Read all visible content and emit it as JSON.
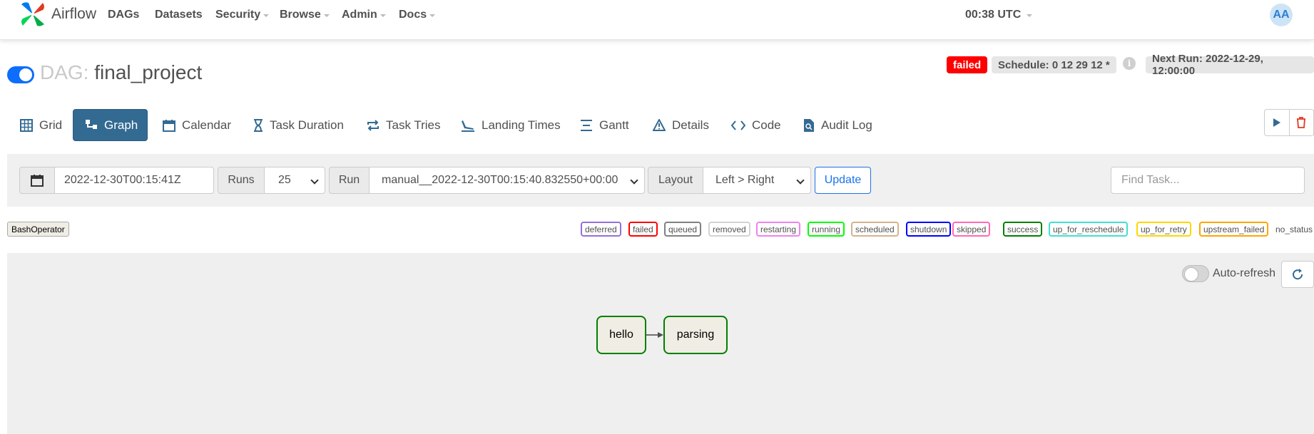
{
  "brand": {
    "name": "Airflow"
  },
  "nav": {
    "items": [
      {
        "label": "DAGs",
        "dropdown": false
      },
      {
        "label": "Datasets",
        "dropdown": false
      },
      {
        "label": "Security",
        "dropdown": true
      },
      {
        "label": "Browse",
        "dropdown": true
      },
      {
        "label": "Admin",
        "dropdown": true
      },
      {
        "label": "Docs",
        "dropdown": true
      }
    ],
    "clock": "00:38 UTC",
    "avatar_initials": "AA"
  },
  "dag": {
    "prefix": "DAG:",
    "name": "final_project",
    "paused": false,
    "status_badge": "failed",
    "schedule": "Schedule: 0 12 29 12 *",
    "next_run": "Next Run: 2022-12-29, 12:00:00"
  },
  "tabs": [
    {
      "label": "Grid",
      "icon": "grid-icon",
      "active": false
    },
    {
      "label": "Graph",
      "icon": "graph-icon",
      "active": true
    },
    {
      "label": "Calendar",
      "icon": "calendar-icon",
      "active": false
    },
    {
      "label": "Task Duration",
      "icon": "hourglass-icon",
      "active": false
    },
    {
      "label": "Task Tries",
      "icon": "retry-icon",
      "active": false
    },
    {
      "label": "Landing Times",
      "icon": "landing-icon",
      "active": false
    },
    {
      "label": "Gantt",
      "icon": "gantt-icon",
      "active": false
    },
    {
      "label": "Details",
      "icon": "warning-icon",
      "active": false
    },
    {
      "label": "Code",
      "icon": "code-icon",
      "active": false
    },
    {
      "label": "Audit Log",
      "icon": "search-file-icon",
      "active": false
    }
  ],
  "controls": {
    "base_date": "2022-12-30T00:15:41Z",
    "runs_label": "Runs",
    "runs_value": "25",
    "run_label": "Run",
    "run_value": "manual__2022-12-30T00:15:40.832550+00:00",
    "layout_label": "Layout",
    "layout_value": "Left > Right",
    "update_label": "Update",
    "find_placeholder": "Find Task..."
  },
  "legend": {
    "operator": "BashOperator",
    "states": [
      {
        "label": "deferred",
        "color": "#9370db"
      },
      {
        "label": "failed",
        "color": "#ff0000"
      },
      {
        "label": "queued",
        "color": "#808080"
      },
      {
        "label": "removed",
        "color": "#d3d3d3"
      },
      {
        "label": "restarting",
        "color": "#ee82ee"
      },
      {
        "label": "running",
        "color": "#00ff00"
      },
      {
        "label": "scheduled",
        "color": "#d2b48c"
      },
      {
        "label": "shutdown",
        "color": "#0000ff"
      },
      {
        "label": "skipped",
        "color": "#ff69b4"
      },
      {
        "label": "success",
        "color": "#008000"
      },
      {
        "label": "up_for_reschedule",
        "color": "#40e0d0"
      },
      {
        "label": "up_for_retry",
        "color": "#ffd700"
      },
      {
        "label": "upstream_failed",
        "color": "#ffa500"
      }
    ],
    "no_status": "no_status"
  },
  "graph": {
    "auto_refresh_label": "Auto-refresh",
    "auto_refresh_on": false,
    "nodes": [
      {
        "id": "hello",
        "state": "success"
      },
      {
        "id": "parsing",
        "state": "success"
      }
    ],
    "edges": [
      {
        "from": "hello",
        "to": "parsing"
      }
    ]
  }
}
